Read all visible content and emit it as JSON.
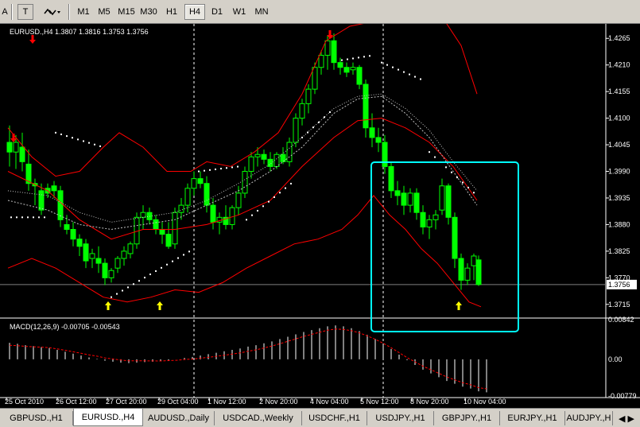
{
  "toolbar": {
    "left_letter": "A",
    "text_tool": "T",
    "timeframes": [
      "M1",
      "M5",
      "M15",
      "M30",
      "H1",
      "H4",
      "D1",
      "W1",
      "MN"
    ],
    "active_timeframe": "H4"
  },
  "chart": {
    "symbol_info": "EURUSD.,H4  1.3807 1.3816 1.3753 1.3756",
    "current_price": "1.3756",
    "price_labels": [
      "1.4265",
      "1.4210",
      "1.4155",
      "1.4100",
      "1.4045",
      "1.3990",
      "1.3935",
      "1.3880",
      "1.3825",
      "1.3770",
      "1.3715"
    ],
    "time_labels": [
      "25 Oct 2010",
      "26 Oct 12:00",
      "27 Oct 20:00",
      "29 Oct 04:00",
      "1 Nov 12:00",
      "2 Nov 20:00",
      "4 Nov 04:00",
      "5 Nov 12:00",
      "8 Nov 20:00",
      "10 Nov 04:00"
    ],
    "macd_label": "MACD(12,26,9) -0.00705 -0.00543",
    "macd_scale": [
      "0.00842",
      "0.00",
      "-0.00779"
    ],
    "colors": {
      "background": "#000000",
      "candle": "#00ff00",
      "bands": "#ff0000",
      "ma": "#c0c0c0",
      "sar": "#ffffff",
      "highlight_box": "#00ffff",
      "down_arrow": "#ff0000",
      "up_arrow": "#ffff00"
    },
    "icons": [
      "down-arrow-icon",
      "up-arrow-icon"
    ]
  },
  "tabs": [
    "GBPUSD.,H1",
    "EURUSD.,H4",
    "AUDUSD.,Daily",
    "USDCAD.,Weekly",
    "USDCHF.,H1",
    "USDJPY.,H1",
    "GBPJPY.,H1",
    "EURJPY.,H1",
    "AUDJPY.,H"
  ],
  "active_tab": "EURUSD.,H4"
}
